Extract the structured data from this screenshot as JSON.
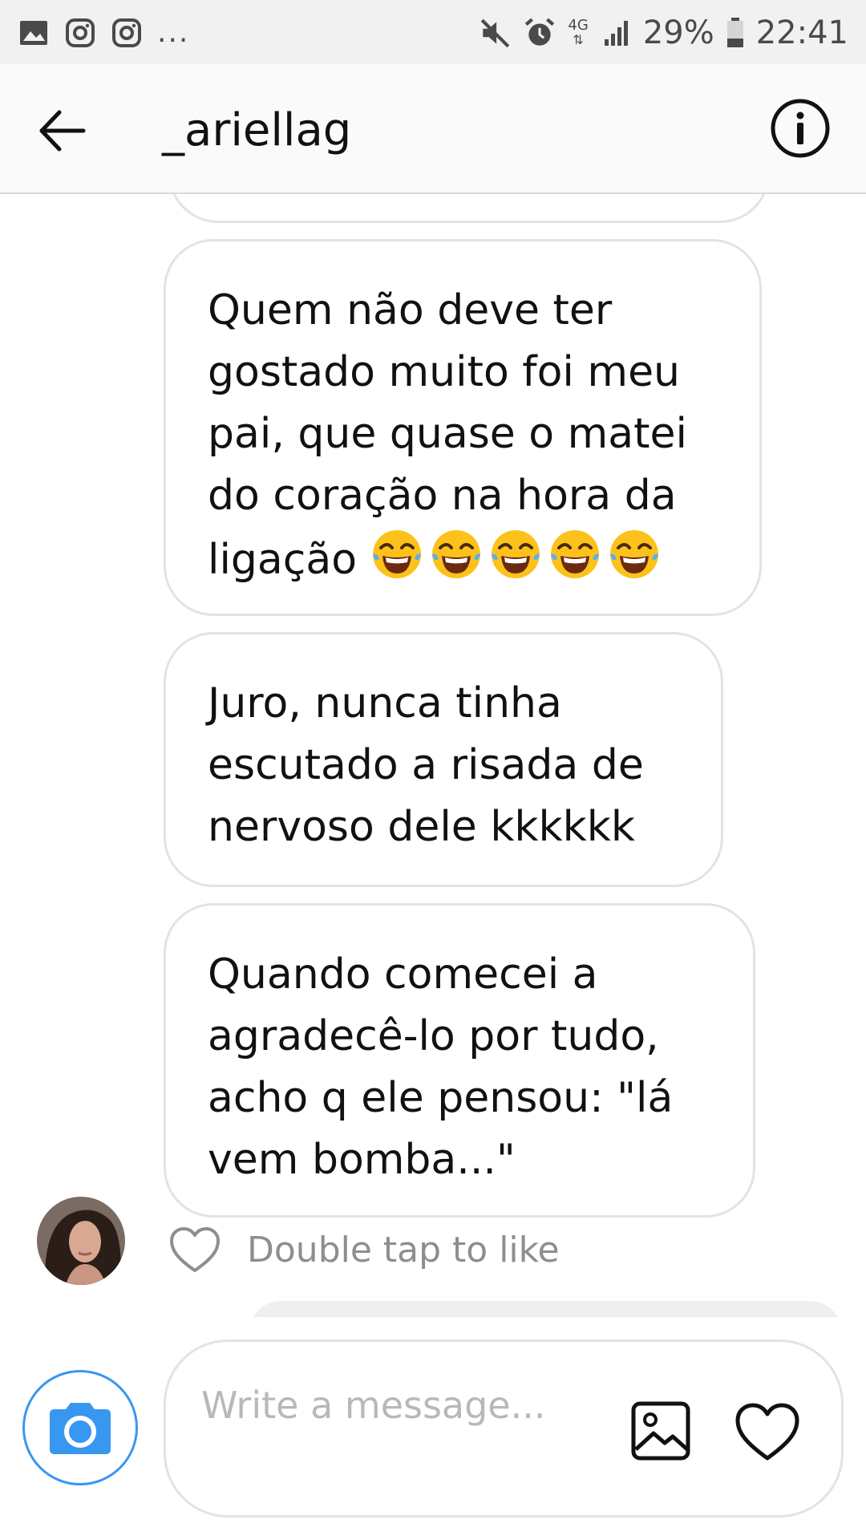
{
  "status_bar": {
    "left_icons": [
      "image-icon",
      "instagram-icon",
      "instagram-icon"
    ],
    "more_indicator": "...",
    "network_label": "4G",
    "battery_percent": "29%",
    "time": "22:41"
  },
  "header": {
    "back_icon": "arrow-left-icon",
    "title": "_ariellag",
    "info_icon": "info-circle-icon"
  },
  "messages": [
    {
      "text": "Quem não deve ter gostado muito foi meu pai, que quase o matei do coração na hora da ligação",
      "lines": [
        "Quem não deve ter",
        "gostado muito foi meu",
        "pai, que quase o matei",
        "do coração na hora da",
        "ligação"
      ],
      "emoji": "face-with-tears-of-joy",
      "emoji_count": 5
    },
    {
      "text": "Juro, nunca tinha escutado a risada de nervoso dele kkkkkk",
      "lines": [
        "Juro, nunca tinha",
        "escutado a risada de",
        "nervoso dele kkkkkk"
      ]
    },
    {
      "text": "Quando comecei a agradecê-lo por tudo, acho q ele pensou: \"lá vem bomba...\"",
      "lines": [
        "Quando comecei a",
        "agradecê-lo por tudo,",
        "acho q ele pensou: \"lá",
        "vem bomba...\""
      ]
    }
  ],
  "like_hint": {
    "icon": "heart-outline-icon",
    "text": "Double tap to like"
  },
  "composer": {
    "camera_icon": "camera-icon",
    "placeholder": "Write a message...",
    "gallery_icon": "gallery-icon",
    "heart_icon": "heart-outline-icon"
  },
  "colors": {
    "accent": "#3897f0",
    "bubble_border": "#e3e3e3",
    "status_bar_bg": "#f1f1f1",
    "header_bg": "#fafafa",
    "placeholder_text": "#b8b8b8",
    "muted_text": "#8e8e8e"
  }
}
